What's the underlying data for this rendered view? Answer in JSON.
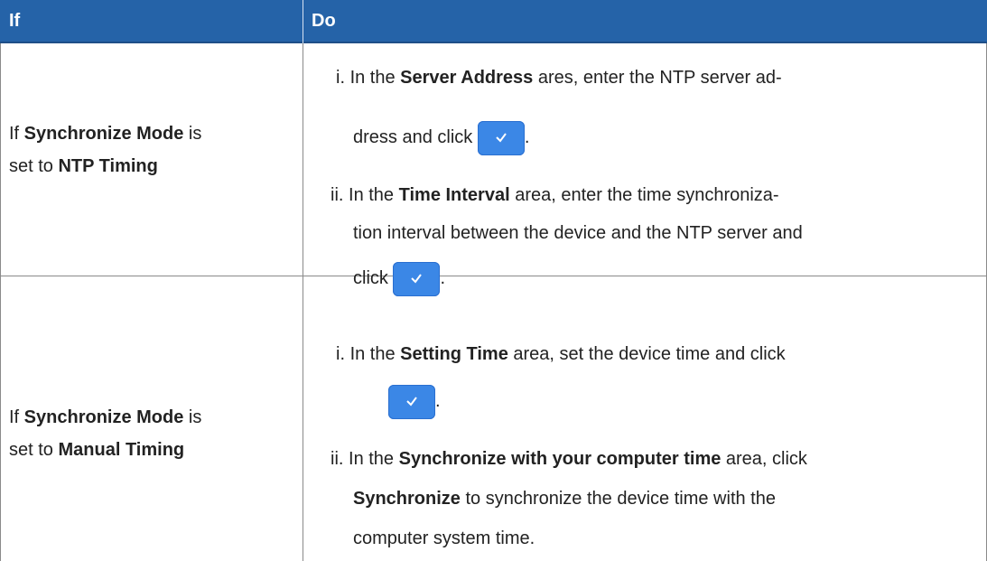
{
  "header": {
    "col_if": "If",
    "col_do": "Do"
  },
  "rows": [
    {
      "if_prefix": "If ",
      "if_bold1": "Synchronize Mode",
      "if_mid": " is",
      "if_line2_prefix": "set to ",
      "if_bold2": "NTP Timing",
      "steps": [
        {
          "marker": "i.",
          "l1_pre": "In the ",
          "l1_bold": "Server Address",
          "l1_post": " ares, enter the NTP server ad-",
          "l2_pre": "dress and click ",
          "l2_post": "."
        },
        {
          "marker": "ii.",
          "l1_pre": "In the ",
          "l1_bold": "Time Interval",
          "l1_post": " area, enter the time synchroniza-",
          "l2_pre": "tion interval between the device and the NTP server and",
          "l3_pre": "click ",
          "l3_post": "."
        }
      ]
    },
    {
      "if_prefix": "If ",
      "if_bold1": "Synchronize Mode",
      "if_mid": " is",
      "if_line2_prefix": "set to ",
      "if_bold2": "Manual Timing",
      "steps": [
        {
          "marker": "i.",
          "l1_pre": "In the ",
          "l1_bold": "Setting Time",
          "l1_post": " area, set the device time and click",
          "l2_post": "."
        },
        {
          "marker": "ii.",
          "l1_pre": "In the ",
          "l1_bold": "Synchronize with your computer time",
          "l1_post": " area, click",
          "l2_bold": "Synchronize",
          "l2_post": " to synchronize the device time with the",
          "l3_pre": "computer system time."
        }
      ]
    }
  ],
  "icons": {
    "confirm_button": "checkmark-icon",
    "button_color": "#3b87e6"
  },
  "colors": {
    "header_bg": "#2563a8",
    "header_text": "#ffffff",
    "border": "#8a8a8a"
  }
}
